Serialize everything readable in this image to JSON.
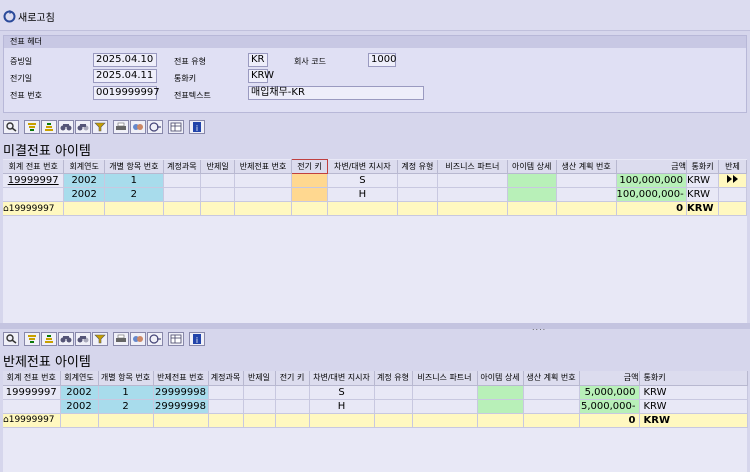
{
  "toolbar_top": {
    "refresh_label": "새로고침"
  },
  "header": {
    "title": "전표 헤더",
    "labels": {
      "doc_date": "증빙일",
      "post_date": "전기일",
      "doc_no": "전표 번호",
      "doc_type": "전표 유형",
      "currency": "통화키",
      "doc_text": "전표텍스트",
      "company_code": "회사 코드"
    },
    "values": {
      "doc_date": "2025.04.10",
      "post_date": "2025.04.11",
      "doc_no": "0019999997",
      "doc_type": "KR",
      "currency": "KRW",
      "doc_text": "매입채무-KR",
      "company_code": "1000"
    }
  },
  "open_items": {
    "title": "미결전표 아이템",
    "columns": [
      "회계 전표 번호",
      "회계연도",
      "개별 항목 번호",
      "계정과목",
      "반제일",
      "반제전표 번호",
      "전기 키",
      "차변/대변 지시자",
      "계정 유형",
      "비즈니스 파트너",
      "아이템 상세",
      "생산 계획 번호",
      "금액",
      "통화키",
      "반제"
    ],
    "rows": [
      {
        "doc_no": "19999997",
        "year": "2002",
        "item": "1",
        "dc": "S",
        "amount": "100,000,000",
        "currency": "KRW"
      },
      {
        "doc_no": "",
        "year": "2002",
        "item": "2",
        "dc": "H",
        "amount": "100,000,000-",
        "currency": "KRW"
      }
    ],
    "summary": {
      "doc_no": "19999997",
      "amount": "0",
      "currency": "KRW"
    }
  },
  "cleared_items": {
    "title": "반제전표 아이템",
    "columns": [
      "회계 전표 번호",
      "회계연도",
      "개별 항목 번호",
      "반제전표 번호",
      "계정과목",
      "반제일",
      "전기 키",
      "차변/대변 지시자",
      "계정 유형",
      "비즈니스 파트너",
      "아이템 상세",
      "생산 계획 번호",
      "금액",
      "통화키"
    ],
    "rows": [
      {
        "doc_no": "19999997",
        "year": "2002",
        "item": "1",
        "clr_doc": "29999998",
        "dc": "S",
        "amount": "5,000,000",
        "currency": "KRW"
      },
      {
        "doc_no": "",
        "year": "2002",
        "item": "2",
        "clr_doc": "29999998",
        "dc": "H",
        "amount": "5,000,000-",
        "currency": "KRW"
      }
    ],
    "summary": {
      "doc_no": "19999997",
      "amount": "0",
      "currency": "KRW"
    }
  },
  "colors": {
    "blue_cell": "#a8dcec",
    "green_cell": "#b8f0b8",
    "orange_cell": "#ffd890",
    "sum_row": "#fff8c0"
  },
  "icons": [
    "refresh-icon",
    "zoom-icon",
    "sort-ascending-icon",
    "sort-descending-icon",
    "find-icon",
    "find-next-icon",
    "filter-icon",
    "print-icon",
    "view-icon",
    "export-icon",
    "layout-icon",
    "info-icon",
    "summary-icon",
    "execute-icon"
  ]
}
